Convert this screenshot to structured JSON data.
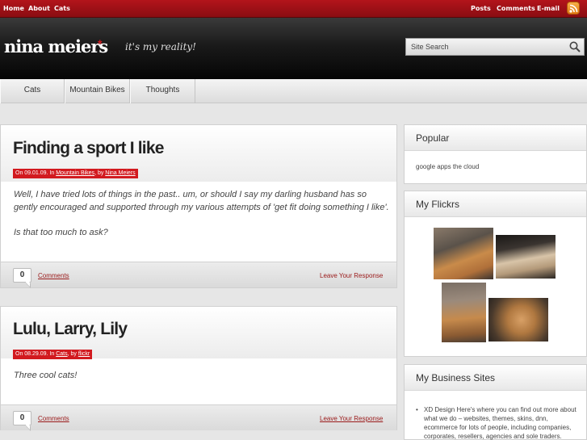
{
  "topbar": {
    "left_links": [
      "Home",
      "About",
      "Cats"
    ],
    "right_links": [
      "Posts",
      "Comments",
      "E-mail"
    ],
    "rss_icon": "rss-icon"
  },
  "header": {
    "logo": "nina meiers",
    "logo_mark": "*",
    "tagline": "it's my reality!",
    "search_placeholder": "Site Search",
    "search_icon": "magnifier-icon"
  },
  "nav": {
    "items": [
      "Cats",
      "Mountain Bikes",
      "Thoughts"
    ]
  },
  "posts": [
    {
      "title": "Finding a sport I like",
      "meta_prefix": "On 09.01.09. In ",
      "category": "Mountain Bikes",
      "meta_by": ", by ",
      "author": "Nina Meiers",
      "body": [
        "Well, I have tried lots of things in the past.. um, or should I say my darling husband has so gently encouraged and supported through my various attempts of 'get fit doing something I like'.",
        "Is that too much to ask?"
      ],
      "comment_count": "0",
      "comments_label": "Comments",
      "respond_label": "Leave Your Response"
    },
    {
      "title": "Lulu, Larry, Lily",
      "meta_prefix": "On 08.29.09. In ",
      "category": "Cats",
      "meta_by": ", by ",
      "author": "flickr",
      "body": [
        "Three cool cats!"
      ],
      "comment_count": "0",
      "comments_label": "Comments",
      "respond_label": "Leave Your Response"
    }
  ],
  "sidebar": {
    "popular": {
      "title": "Popular",
      "items": [
        "google apps the cloud"
      ]
    },
    "flickr": {
      "title": "My Flickrs"
    },
    "business": {
      "title": "My Business Sites",
      "items": [
        "XD Design Here's where you can find out more about what we do – websites, themes, skins, dnn, ecommerce for lots of people, including companies, corporates, resellers, agencies and sole traders."
      ]
    }
  },
  "colors": {
    "accent": "#d21a1f",
    "topbar": "#a8131a",
    "header": "#111111"
  }
}
